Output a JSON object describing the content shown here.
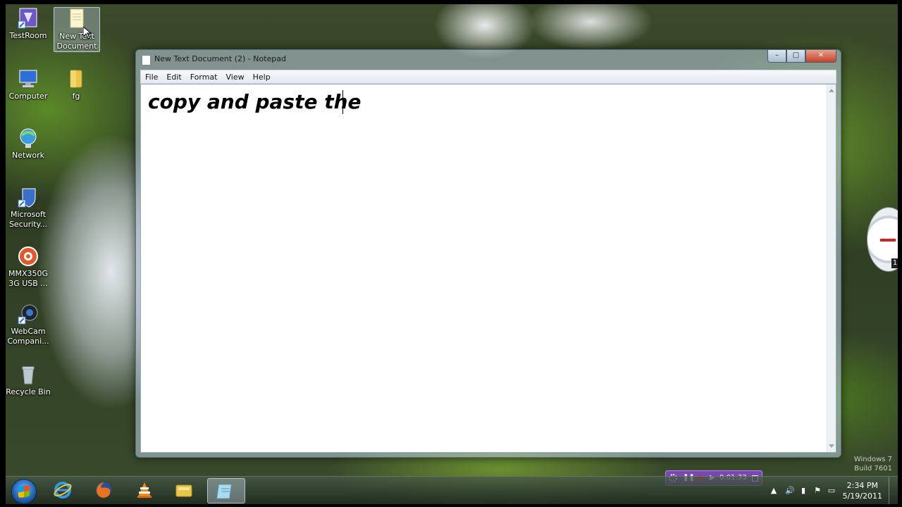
{
  "desktop": {
    "icons": [
      {
        "label": "TestRoom"
      },
      {
        "label": "New Text Document"
      },
      {
        "label": "Computer"
      },
      {
        "label": "fg"
      },
      {
        "label": "Network"
      },
      {
        "label": "Microsoft Security..."
      },
      {
        "label": "MMX350G 3G USB ..."
      },
      {
        "label": "WebCam Compani..."
      },
      {
        "label": "Recycle Bin"
      }
    ],
    "watermark": {
      "line1": "Windows 7",
      "line2": "Build 7601"
    }
  },
  "window": {
    "title": "New Text Document (2) - Notepad",
    "controls": {
      "minimize": "–",
      "maximize": "□",
      "close": "✕"
    },
    "menu": [
      "File",
      "Edit",
      "Format",
      "View",
      "Help"
    ],
    "content": "copy and paste the"
  },
  "recorder": {
    "time": "0:01:33"
  },
  "gadget": {
    "value": "1"
  },
  "taskbar": {
    "clock_time": "2:34 PM",
    "clock_date": "5/19/2011",
    "pinned": [
      "internet-explorer-icon",
      "firefox-icon",
      "vlc-icon",
      "explorer-icon",
      "notepad-icon"
    ]
  },
  "colors": {
    "taskbar": "#2e3d22",
    "close_button": "#c5402a",
    "recorder": "#7a45b5"
  }
}
